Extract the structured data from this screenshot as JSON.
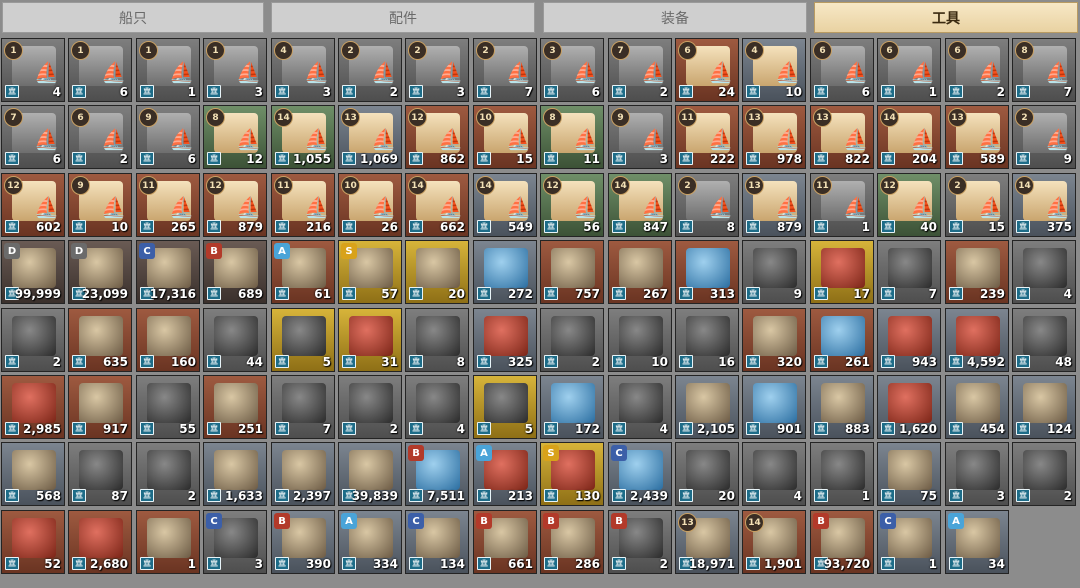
{
  "tabs": [
    "船只",
    "配件",
    "装备",
    "工具"
  ],
  "active_tab": 3,
  "bank_icon_glyph": "🏛",
  "grid": [
    [
      {
        "badge": "1",
        "qty": "4",
        "bg": "gray",
        "art": "scroll-gray",
        "icon": "ship-blueprint-icon"
      },
      {
        "badge": "1",
        "qty": "6",
        "bg": "gray",
        "art": "scroll-gray",
        "icon": "ship-blueprint-icon"
      },
      {
        "badge": "1",
        "qty": "1",
        "bg": "gray",
        "art": "scroll-gray",
        "icon": "ship-blueprint-icon"
      },
      {
        "badge": "1",
        "qty": "3",
        "bg": "gray",
        "art": "scroll-gray",
        "icon": "ship-blueprint-icon"
      },
      {
        "badge": "4",
        "qty": "3",
        "bg": "gray",
        "art": "scroll-gray",
        "icon": "ship-blueprint-icon"
      },
      {
        "badge": "2",
        "qty": "2",
        "bg": "gray",
        "art": "scroll-gray",
        "icon": "ship-blueprint-icon"
      },
      {
        "badge": "2",
        "qty": "3",
        "bg": "gray",
        "art": "scroll-gray",
        "icon": "ship-blueprint-icon"
      },
      {
        "badge": "2",
        "qty": "7",
        "bg": "gray",
        "art": "scroll-gray",
        "icon": "ship-blueprint-icon"
      },
      {
        "badge": "3",
        "qty": "6",
        "bg": "gray",
        "art": "scroll-gray",
        "icon": "ship-blueprint-icon"
      },
      {
        "badge": "7",
        "qty": "2",
        "bg": "gray",
        "art": "scroll-gray",
        "icon": "ship-blueprint-icon"
      },
      {
        "badge": "6",
        "qty": "24",
        "bg": "brown",
        "art": "scroll-tan",
        "icon": "ship-blueprint-icon"
      },
      {
        "badge": "4",
        "qty": "10",
        "bg": "slate",
        "art": "scroll-tan",
        "icon": "ship-blueprint-icon"
      },
      {
        "badge": "6",
        "qty": "6",
        "bg": "gray",
        "art": "scroll-gray",
        "icon": "ship-blueprint-icon"
      },
      {
        "badge": "6",
        "qty": "1",
        "bg": "gray",
        "art": "scroll-gray",
        "icon": "ship-blueprint-icon"
      },
      {
        "badge": "6",
        "qty": "2",
        "bg": "gray",
        "art": "scroll-gray",
        "icon": "ship-blueprint-icon"
      },
      {
        "badge": "8",
        "qty": "7",
        "bg": "gray",
        "art": "scroll-gray",
        "icon": "ship-blueprint-icon"
      }
    ],
    [
      {
        "badge": "7",
        "qty": "6",
        "bg": "gray",
        "art": "scroll-gray",
        "icon": "ship-blueprint-icon"
      },
      {
        "badge": "6",
        "qty": "2",
        "bg": "gray",
        "art": "scroll-gray",
        "icon": "ship-blueprint-icon"
      },
      {
        "badge": "9",
        "qty": "6",
        "bg": "gray",
        "art": "scroll-gray",
        "icon": "ship-blueprint-icon"
      },
      {
        "badge": "8",
        "qty": "12",
        "bg": "green",
        "art": "scroll-tan",
        "icon": "ship-blueprint-icon"
      },
      {
        "badge": "14",
        "qty": "1,055",
        "bg": "green",
        "art": "scroll-tan",
        "icon": "ship-blueprint-icon"
      },
      {
        "badge": "13",
        "qty": "1,069",
        "bg": "slate",
        "art": "scroll-tan",
        "icon": "ship-blueprint-icon"
      },
      {
        "badge": "12",
        "qty": "862",
        "bg": "brown",
        "art": "scroll-tan",
        "icon": "ship-blueprint-icon"
      },
      {
        "badge": "10",
        "qty": "15",
        "bg": "brown",
        "art": "scroll-tan",
        "icon": "ship-blueprint-icon"
      },
      {
        "badge": "8",
        "qty": "11",
        "bg": "green",
        "art": "scroll-tan",
        "icon": "ship-blueprint-icon"
      },
      {
        "badge": "9",
        "qty": "3",
        "bg": "gray",
        "art": "scroll-gray",
        "icon": "ship-blueprint-icon"
      },
      {
        "badge": "11",
        "qty": "222",
        "bg": "brown",
        "art": "scroll-tan",
        "icon": "ship-blueprint-icon"
      },
      {
        "badge": "13",
        "qty": "978",
        "bg": "brown",
        "art": "scroll-tan",
        "icon": "ship-blueprint-icon"
      },
      {
        "badge": "13",
        "qty": "822",
        "bg": "brown",
        "art": "scroll-tan",
        "icon": "ship-blueprint-icon"
      },
      {
        "badge": "14",
        "qty": "204",
        "bg": "brown",
        "art": "scroll-tan",
        "icon": "ship-blueprint-icon"
      },
      {
        "badge": "13",
        "qty": "589",
        "bg": "brown",
        "art": "scroll-tan",
        "icon": "ship-blueprint-icon"
      },
      {
        "badge": "2",
        "qty": "9",
        "bg": "gray",
        "art": "scroll-gray",
        "icon": "ship-blueprint-icon"
      }
    ],
    [
      {
        "badge": "12",
        "qty": "602",
        "bg": "brown",
        "art": "scroll-tan",
        "icon": "ship-blueprint-icon"
      },
      {
        "badge": "9",
        "qty": "10",
        "bg": "brown",
        "art": "scroll-tan",
        "icon": "ship-blueprint-icon"
      },
      {
        "badge": "11",
        "qty": "265",
        "bg": "brown",
        "art": "scroll-tan",
        "icon": "ship-blueprint-icon"
      },
      {
        "badge": "12",
        "qty": "879",
        "bg": "brown",
        "art": "scroll-tan",
        "icon": "ship-blueprint-icon"
      },
      {
        "badge": "11",
        "qty": "216",
        "bg": "brown",
        "art": "scroll-tan",
        "icon": "ship-blueprint-icon"
      },
      {
        "badge": "10",
        "qty": "26",
        "bg": "brown",
        "art": "scroll-tan",
        "icon": "ship-blueprint-icon"
      },
      {
        "badge": "14",
        "qty": "662",
        "bg": "brown",
        "art": "scroll-tan",
        "icon": "ship-blueprint-icon"
      },
      {
        "badge": "14",
        "qty": "549",
        "bg": "slate",
        "art": "scroll-tan",
        "icon": "ship-blueprint-icon"
      },
      {
        "badge": "12",
        "qty": "56",
        "bg": "green",
        "art": "scroll-tan",
        "icon": "ship-blueprint-icon"
      },
      {
        "badge": "14",
        "qty": "847",
        "bg": "green",
        "art": "scroll-tan",
        "icon": "ship-blueprint-icon"
      },
      {
        "badge": "2",
        "qty": "8",
        "bg": "gray",
        "art": "scroll-gray",
        "icon": "ship-blueprint-icon"
      },
      {
        "badge": "13",
        "qty": "879",
        "bg": "slate",
        "art": "scroll-tan",
        "icon": "ship-blueprint-icon"
      },
      {
        "badge": "11",
        "qty": "1",
        "bg": "gray",
        "art": "scroll-gray",
        "icon": "ship-blueprint-icon"
      },
      {
        "badge": "12",
        "qty": "40",
        "bg": "green",
        "art": "scroll-tan",
        "icon": "ship-blueprint-icon"
      },
      {
        "badge": "2",
        "qty": "15",
        "bg": "gray",
        "art": "scroll-tan",
        "icon": "ship-blueprint-icon"
      },
      {
        "badge": "14",
        "qty": "375",
        "bg": "slate",
        "art": "scroll-tan",
        "icon": "ship-blueprint-icon"
      }
    ],
    [
      {
        "grade": "D",
        "qty": "99,999",
        "bg": "dark",
        "art": "item",
        "icon": "astrolabe-icon"
      },
      {
        "grade": "D",
        "qty": "23,099",
        "bg": "dark",
        "art": "item",
        "icon": "astrolabe-icon"
      },
      {
        "grade": "C",
        "qty": "17,316",
        "bg": "dark",
        "art": "item",
        "icon": "astrolabe-icon"
      },
      {
        "grade": "B",
        "qty": "689",
        "bg": "dark",
        "art": "item",
        "icon": "silver-astrolabe-icon"
      },
      {
        "grade": "A",
        "qty": "61",
        "bg": "brown",
        "art": "item",
        "icon": "pocket-watch-icon"
      },
      {
        "grade": "S",
        "qty": "57",
        "bg": "gold",
        "art": "item",
        "icon": "pocket-watch-icon"
      },
      {
        "qty": "20",
        "bg": "gold",
        "art": "item",
        "icon": "teacup-icon"
      },
      {
        "qty": "272",
        "bg": "slate",
        "art": "item-blue",
        "icon": "vase-icon"
      },
      {
        "qty": "757",
        "bg": "brown",
        "art": "item",
        "icon": "cloth-icon"
      },
      {
        "qty": "267",
        "bg": "brown",
        "art": "item",
        "icon": "cloth-icon"
      },
      {
        "qty": "313",
        "bg": "brown",
        "art": "item-blue",
        "icon": "cloth-icon"
      },
      {
        "qty": "9",
        "bg": "gray",
        "art": "item-dark",
        "icon": "cloth-icon"
      },
      {
        "qty": "17",
        "bg": "gold",
        "art": "item-red",
        "icon": "cake-icon"
      },
      {
        "qty": "7",
        "bg": "gray",
        "art": "item-dark",
        "icon": "fan-icon"
      },
      {
        "qty": "239",
        "bg": "brown",
        "art": "item",
        "icon": "fan-icon"
      },
      {
        "qty": "4",
        "bg": "gray",
        "art": "item-dark",
        "icon": "feather-icon"
      }
    ],
    [
      {
        "qty": "2",
        "bg": "gray",
        "art": "item-dark",
        "icon": "book-icon"
      },
      {
        "qty": "635",
        "bg": "brown",
        "art": "item",
        "icon": "book-icon"
      },
      {
        "qty": "160",
        "bg": "brown",
        "art": "item",
        "icon": "book-icon"
      },
      {
        "qty": "44",
        "bg": "gray",
        "art": "item-dark",
        "icon": "tool-icon"
      },
      {
        "qty": "5",
        "bg": "gold",
        "art": "item-dark",
        "icon": "scissors-icon"
      },
      {
        "qty": "31",
        "bg": "gold",
        "art": "item-red",
        "icon": "scissors-icon"
      },
      {
        "qty": "8",
        "bg": "gray",
        "art": "item-dark",
        "icon": "pipe-icon"
      },
      {
        "qty": "325",
        "bg": "slate",
        "art": "item-red",
        "icon": "pipe-icon"
      },
      {
        "qty": "2",
        "bg": "gray",
        "art": "item-dark",
        "icon": "pipe-icon"
      },
      {
        "qty": "10",
        "bg": "gray",
        "art": "item-dark",
        "icon": "tool-icon"
      },
      {
        "qty": "16",
        "bg": "gray",
        "art": "item-dark",
        "icon": "tool-icon"
      },
      {
        "qty": "320",
        "bg": "brown",
        "art": "item",
        "icon": "llama-figurine-icon"
      },
      {
        "qty": "261",
        "bg": "brown",
        "art": "item-blue",
        "icon": "teapot-icon"
      },
      {
        "qty": "943",
        "bg": "slate",
        "art": "item-red",
        "icon": "box-icon"
      },
      {
        "qty": "4,592",
        "bg": "slate",
        "art": "item-red",
        "icon": "box-icon"
      },
      {
        "qty": "48",
        "bg": "gray",
        "art": "item-dark",
        "icon": "box-icon"
      }
    ],
    [
      {
        "qty": "2,985",
        "bg": "brown",
        "art": "item-red",
        "icon": "crab-icon"
      },
      {
        "qty": "917",
        "bg": "brown",
        "art": "item",
        "icon": "map-icon"
      },
      {
        "qty": "55",
        "bg": "gray",
        "art": "item-dark",
        "icon": "map-icon"
      },
      {
        "qty": "251",
        "bg": "brown",
        "art": "item",
        "icon": "map-icon"
      },
      {
        "qty": "7",
        "bg": "gray",
        "art": "item-dark",
        "icon": "map-icon"
      },
      {
        "qty": "2",
        "bg": "gray",
        "art": "item-dark",
        "icon": "stone-icon"
      },
      {
        "qty": "4",
        "bg": "gray",
        "art": "item-dark",
        "icon": "stone-icon"
      },
      {
        "qty": "5",
        "bg": "gold",
        "art": "item-dark",
        "icon": "pot-icon"
      },
      {
        "qty": "172",
        "bg": "slate",
        "art": "item-blue",
        "icon": "fish-icon"
      },
      {
        "qty": "4",
        "bg": "gray",
        "art": "item-dark",
        "icon": "snake-icon"
      },
      {
        "qty": "2,105",
        "bg": "slate",
        "art": "item",
        "icon": "cheese-icon"
      },
      {
        "qty": "901",
        "bg": "slate",
        "art": "item-blue",
        "icon": "fin-icon"
      },
      {
        "qty": "883",
        "bg": "slate",
        "art": "item",
        "icon": "bread-icon"
      },
      {
        "qty": "1,620",
        "bg": "slate",
        "art": "item-red",
        "icon": "lobster-icon"
      },
      {
        "qty": "454",
        "bg": "slate",
        "art": "item",
        "icon": "shell-icon"
      },
      {
        "qty": "124",
        "bg": "slate",
        "art": "item",
        "icon": "starfish-icon"
      }
    ],
    [
      {
        "qty": "568",
        "bg": "slate",
        "art": "item",
        "icon": "scroll-icon"
      },
      {
        "qty": "87",
        "bg": "gray",
        "art": "item-dark",
        "icon": "statue-icon"
      },
      {
        "qty": "2",
        "bg": "gray",
        "art": "item-dark",
        "icon": "tool-icon"
      },
      {
        "qty": "1,633",
        "bg": "slate",
        "art": "item",
        "icon": "open-book-icon"
      },
      {
        "qty": "2,397",
        "bg": "slate",
        "art": "item",
        "icon": "open-book-icon"
      },
      {
        "qty": "39,839",
        "bg": "slate",
        "art": "item",
        "icon": "chest-icon"
      },
      {
        "grade": "B",
        "qty": "7,511",
        "bg": "slate",
        "art": "item-blue",
        "icon": "manual-icon"
      },
      {
        "grade": "A",
        "qty": "213",
        "bg": "slate",
        "art": "item-red",
        "icon": "manual-icon"
      },
      {
        "grade": "S",
        "qty": "130",
        "bg": "gold",
        "art": "item-red",
        "icon": "manual-icon"
      },
      {
        "grade": "C",
        "qty": "2,439",
        "bg": "slate",
        "art": "item-blue",
        "icon": "manual-icon"
      },
      {
        "qty": "20",
        "bg": "gray",
        "art": "item-dark",
        "icon": "coal-icon"
      },
      {
        "qty": "4",
        "bg": "gray",
        "art": "item-dark",
        "icon": "coal-icon"
      },
      {
        "qty": "1",
        "bg": "gray",
        "art": "item-dark",
        "icon": "coal-icon"
      },
      {
        "qty": "75",
        "bg": "slate",
        "art": "item",
        "icon": "bowl-icon"
      },
      {
        "qty": "3",
        "bg": "gray",
        "art": "item-dark",
        "icon": "food-icon"
      },
      {
        "qty": "2",
        "bg": "gray",
        "art": "item-dark",
        "icon": "food-icon"
      }
    ],
    [
      {
        "qty": "52",
        "bg": "brown",
        "art": "item-red",
        "icon": "meat-skewer-icon"
      },
      {
        "qty": "2,680",
        "bg": "brown",
        "art": "item-red",
        "icon": "meat-icon"
      },
      {
        "qty": "1",
        "bg": "brown",
        "art": "item",
        "icon": "ledger-icon"
      },
      {
        "grade": "C",
        "qty": "3",
        "bg": "gray",
        "art": "item-dark",
        "icon": "ship-frame-icon"
      },
      {
        "grade": "B",
        "qty": "390",
        "bg": "slate",
        "art": "item",
        "icon": "ship-frame-icon"
      },
      {
        "grade": "A",
        "qty": "334",
        "bg": "slate",
        "art": "item",
        "icon": "ship-frame-icon"
      },
      {
        "grade": "C",
        "qty": "134",
        "bg": "slate",
        "art": "item",
        "icon": "lumber-icon"
      },
      {
        "grade": "B",
        "qty": "661",
        "bg": "brown",
        "art": "item",
        "icon": "lumber-icon"
      },
      {
        "grade": "B",
        "qty": "286",
        "bg": "brown",
        "art": "item",
        "icon": "lumber-icon"
      },
      {
        "grade": "B",
        "qty": "2",
        "bg": "gray",
        "art": "item-dark",
        "icon": "lumber-icon"
      },
      {
        "badge": "13",
        "qty": "18,971",
        "bg": "slate",
        "art": "item",
        "icon": "lumber-icon"
      },
      {
        "badge": "14",
        "qty": "1,901",
        "bg": "brown",
        "art": "item",
        "icon": "lumber-icon"
      },
      {
        "grade": "B",
        "qty": "93,720",
        "bg": "brown",
        "art": "item",
        "icon": "lumber-icon"
      },
      {
        "grade": "C",
        "qty": "1",
        "bg": "slate",
        "art": "item",
        "icon": "ship-frame-icon"
      },
      {
        "grade": "A",
        "qty": "34",
        "bg": "slate",
        "art": "item",
        "icon": "ship-frame-icon"
      }
    ]
  ],
  "colors": {
    "grade_D": "#6b6b6b",
    "grade_C": "#3c5fa8",
    "grade_B": "#b23a2a",
    "grade_A": "#4aa4d8",
    "grade_S": "#d8a21a",
    "active_tab": "#e9d2a2"
  }
}
